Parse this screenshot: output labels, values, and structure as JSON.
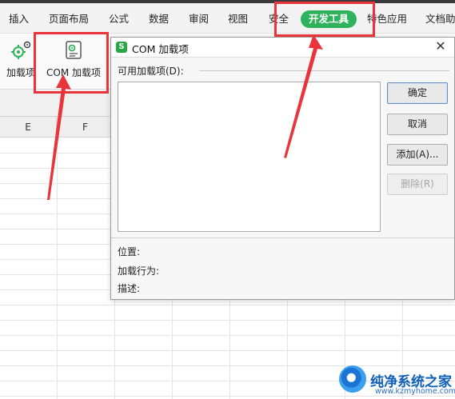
{
  "ribbon_tabs": [
    "插入",
    "页面布局",
    "公式",
    "数据",
    "审阅",
    "视图",
    "安全",
    "开发工具",
    "特色应用",
    "文档助"
  ],
  "active_tab": "开发工具",
  "ribbon_buttons": {
    "addins": "加载项",
    "com_addins": "COM 加载项"
  },
  "columns": [
    "E",
    "F"
  ],
  "dialog": {
    "logo_letter": "S",
    "title": "COM 加载项",
    "close": "✕",
    "available_label": "可用加载项(D):",
    "buttons": {
      "ok": "确定",
      "cancel": "取消",
      "add": "添加(A)...",
      "remove": "删除(R)"
    },
    "location_label": "位置:",
    "load_behavior_label": "加载行为:",
    "description_label": "描述:"
  },
  "watermark": {
    "name": "纯净系统之家",
    "url": "www.kzmyhome.com"
  },
  "colors": {
    "active_tab": "#2fb25c",
    "highlight": "#e8343a",
    "gear_icon": "#2fb25c"
  }
}
